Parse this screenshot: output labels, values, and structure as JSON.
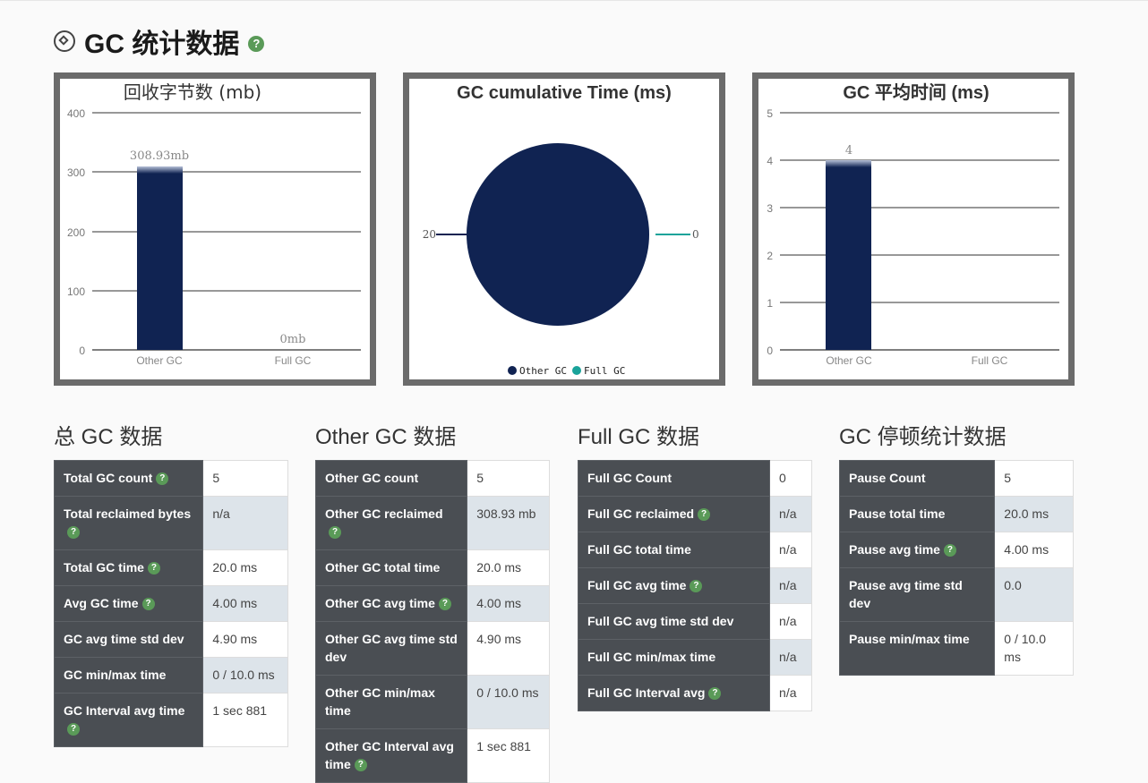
{
  "page": {
    "title": "GC 统计数据"
  },
  "charts": {
    "reclaimed": {
      "title": "回收字节数 (mb)",
      "y_ticks": [
        "400",
        "300",
        "200",
        "100",
        "0"
      ],
      "bar_labels": [
        "308.93mb",
        "0mb"
      ],
      "categories": [
        "Other GC",
        "Full GC"
      ]
    },
    "cumulative": {
      "title": "GC cumulative Time (ms)",
      "slice_labels": [
        "20",
        "0"
      ],
      "legend": [
        "Other GC",
        "Full GC"
      ]
    },
    "avg": {
      "title": "GC 平均时间 (ms)",
      "y_ticks": [
        "5",
        "4",
        "3",
        "2",
        "1",
        "0"
      ],
      "bar_labels": [
        "4"
      ],
      "categories": [
        "Other GC",
        "Full GC"
      ]
    }
  },
  "chart_data": [
    {
      "type": "bar",
      "title": "回收字节数 (mb)",
      "categories": [
        "Other GC",
        "Full GC"
      ],
      "values": [
        308.93,
        0
      ],
      "ylim": [
        0,
        400
      ],
      "ylabel": "",
      "xlabel": ""
    },
    {
      "type": "pie",
      "title": "GC cumulative Time (ms)",
      "categories": [
        "Other GC",
        "Full GC"
      ],
      "values": [
        20,
        0
      ]
    },
    {
      "type": "bar",
      "title": "GC 平均时间 (ms)",
      "categories": [
        "Other GC",
        "Full GC"
      ],
      "values": [
        4,
        null
      ],
      "ylim": [
        0,
        5
      ],
      "ylabel": "",
      "xlabel": ""
    }
  ],
  "colors": {
    "primary": "#102352",
    "secondary": "#1aa39a",
    "key_bg": "#4a4e53",
    "help": "#5a9a58"
  },
  "sections": [
    {
      "title": "总 GC 数据",
      "rows": [
        {
          "k": "Total GC count",
          "v": "5",
          "help": true
        },
        {
          "k": "Total reclaimed bytes",
          "v": "n/a",
          "help": true
        },
        {
          "k": "Total GC time",
          "v": "20.0 ms",
          "help": true
        },
        {
          "k": "Avg GC time",
          "v": "4.00 ms",
          "help": true
        },
        {
          "k": "GC avg time std dev",
          "v": "4.90 ms",
          "help": false
        },
        {
          "k": "GC min/max time",
          "v": "0 / 10.0 ms",
          "help": false
        },
        {
          "k": "GC Interval avg time",
          "v": "1 sec 881",
          "help": true
        }
      ]
    },
    {
      "title": "Other GC 数据",
      "rows": [
        {
          "k": "Other GC count",
          "v": "5",
          "help": false
        },
        {
          "k": "Other GC reclaimed",
          "v": "308.93 mb",
          "help": true
        },
        {
          "k": "Other GC total time",
          "v": "20.0 ms",
          "help": false
        },
        {
          "k": "Other GC avg time",
          "v": "4.00 ms",
          "help": true
        },
        {
          "k": "Other GC avg time std dev",
          "v": "4.90 ms",
          "help": false
        },
        {
          "k": "Other GC min/max time",
          "v": "0 / 10.0 ms",
          "help": false
        },
        {
          "k": "Other GC Interval avg time",
          "v": "1 sec 881",
          "help": true
        }
      ]
    },
    {
      "title": "Full GC 数据",
      "rows": [
        {
          "k": "Full GC Count",
          "v": "0",
          "help": false
        },
        {
          "k": "Full GC reclaimed",
          "v": "n/a",
          "help": true
        },
        {
          "k": "Full GC total time",
          "v": "n/a",
          "help": false
        },
        {
          "k": "Full GC avg time",
          "v": "n/a",
          "help": true
        },
        {
          "k": "Full GC avg time std dev",
          "v": "n/a",
          "help": false
        },
        {
          "k": "Full GC min/max time",
          "v": "n/a",
          "help": false
        },
        {
          "k": "Full GC Interval avg",
          "v": "n/a",
          "help": true
        }
      ]
    },
    {
      "title": "GC 停顿统计数据",
      "rows": [
        {
          "k": "Pause Count",
          "v": "5",
          "help": false
        },
        {
          "k": "Pause total time",
          "v": "20.0 ms",
          "help": false
        },
        {
          "k": "Pause avg time",
          "v": "4.00 ms",
          "help": true
        },
        {
          "k": "Pause avg time std dev",
          "v": "0.0",
          "help": false
        },
        {
          "k": "Pause min/max time",
          "v": "0 / 10.0 ms",
          "help": false
        }
      ]
    }
  ]
}
